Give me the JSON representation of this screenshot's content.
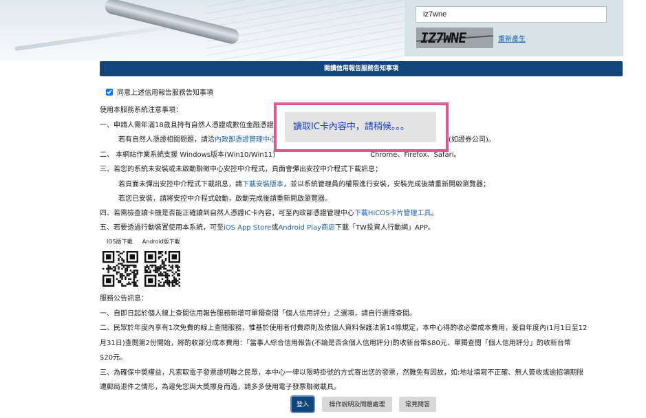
{
  "captcha": {
    "input_value": "iz7wne",
    "image_text": "IZ7WNE",
    "regen_label": "重新產生"
  },
  "title_bar": "閱讀信用報告服務告知事項",
  "agree_label": "同意上述信用報告服務告知事項",
  "notice": {
    "heading": "使用本服務系統注意事項：",
    "item1": "一、申請人需年滿18歲且持有自然人憑證或數位金融憑證",
    "item1_sub_pre": "若有自然人憑證相關問題，請洽",
    "item1_sub_link": "內政部憑證管理中心",
    "item1_sub_post": "機構(如證券公司)。",
    "item2_pre": "二、 本網站作業系統支援 Windows版本(Win10/Win11)",
    "item2_post": "Chrome、Firefox、Safari。",
    "item3": "三、若您的系統未安裝或未啟動聯徵中心安控中介程式，頁面會彈出安控中介程式下載訊息；",
    "item3_sub1_pre": "若頁面未彈出安控中介程式下載訊息，請",
    "item3_sub1_link": "下載安裝版本",
    "item3_sub1_post": "，並以系統管理員的權限進行安裝，安裝完成後請重新開啟瀏覽器；",
    "item3_sub2": "若您已安裝，請將安控中介程式啟動，啟動完成後請重新開啟瀏覽器。",
    "item4_pre": "四、若需檢查讀卡機是否能正確讀到自然人憑證IC卡內容，可至內政部憑證管理中心",
    "item4_link": "下載HiCOS卡片管理工具",
    "item4_post": "。",
    "item5_pre": "五、若要透過行動裝置使用本系統，可至",
    "item5_link1": "iOS App Store",
    "item5_mid": "或",
    "item5_link2": "Android Play商店",
    "item5_post": "下載「TW投資人行動網」APP。"
  },
  "qr": {
    "ios_label": "IOS版下載",
    "android_label": "Android版下載"
  },
  "announcement": {
    "heading": "服務公告訊息：",
    "a1": "一、自即日起於個人線上查閱信用報告服務新增可單獨查閱「個人信用評分」之選項，請自行選擇查閱。",
    "a2_line1": "二、民眾於年度內享有1次免費的線上查閱服務，惟基於使用者付費原則及依個人資料保護法第14條規定，本中心得酌收必要成本費用，爰自年度內(1月1日至12",
    "a2_line2": "月31日)查閱第2份開始，將酌收部分成本費用：「當事人綜合信用報告(不論是否含個人信用評分)酌收新台幣$80元、單獨查閱「個人信用評分」酌收新台幣",
    "a2_line3": "$20元。",
    "a3_line1": "三、為確保中獎權益，凡索取電子發票證明聯之民眾，本中心一律以限時掛號的方式寄出您的發票，然難免有因故，如:地址填寫不正確、無人簽收或逾招領期限",
    "a3_line2": "遭郵局退件之情形，為避免您與大獎擦身而過，請多多使用電子發票聯徵載具。"
  },
  "popup_text": "讀取IC卡內容中，請稍候。。。",
  "buttons": {
    "login": "登入",
    "help": "操作說明及問題處理",
    "faq": "常見問答"
  },
  "colors": {
    "navy": "#12457c",
    "red": "#d0021b",
    "link": "#1a5fb0",
    "popup_border": "#e25590",
    "panel": "#d7e3e7"
  }
}
